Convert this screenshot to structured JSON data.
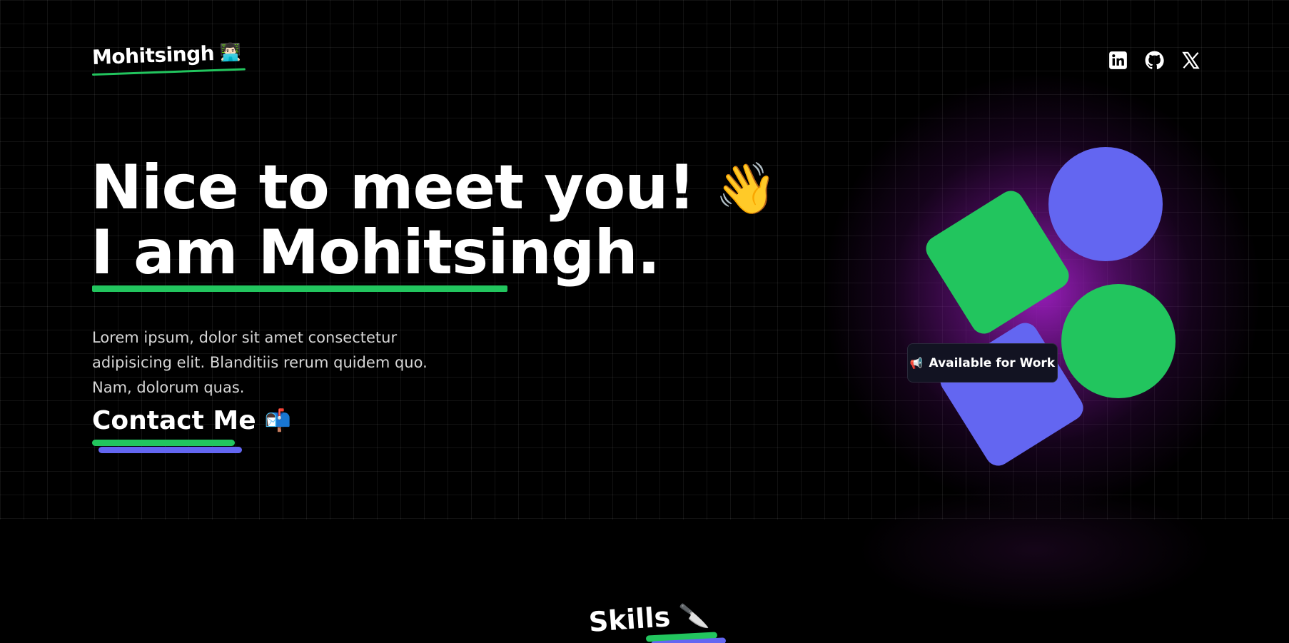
{
  "header": {
    "logo_text": "Mohitsingh",
    "logo_emoji": "👨🏻‍💻",
    "socials": [
      {
        "name": "linkedin",
        "icon": "linkedin-icon"
      },
      {
        "name": "github",
        "icon": "github-icon"
      },
      {
        "name": "x",
        "icon": "x-icon"
      }
    ]
  },
  "hero": {
    "headline_line1": "Nice to meet you!",
    "wave_emoji": "👋",
    "headline_line2": "I am Mohitsingh.",
    "intro": "Lorem ipsum, dolor sit amet consectetur adipisicing elit. Blanditiis rerum quidem quo. Nam, dolorum quas.",
    "contact_label": "Contact Me",
    "contact_emoji": "📬",
    "badge_icon": "📢",
    "badge_text": "Available for Work"
  },
  "skills": {
    "title": "Skills",
    "title_emoji": "🔪"
  },
  "colors": {
    "accent_green": "#22c55e",
    "accent_purple": "#6366f1",
    "glow": "#9b1ebe",
    "background": "#000000",
    "badge_bg": "#121322"
  }
}
